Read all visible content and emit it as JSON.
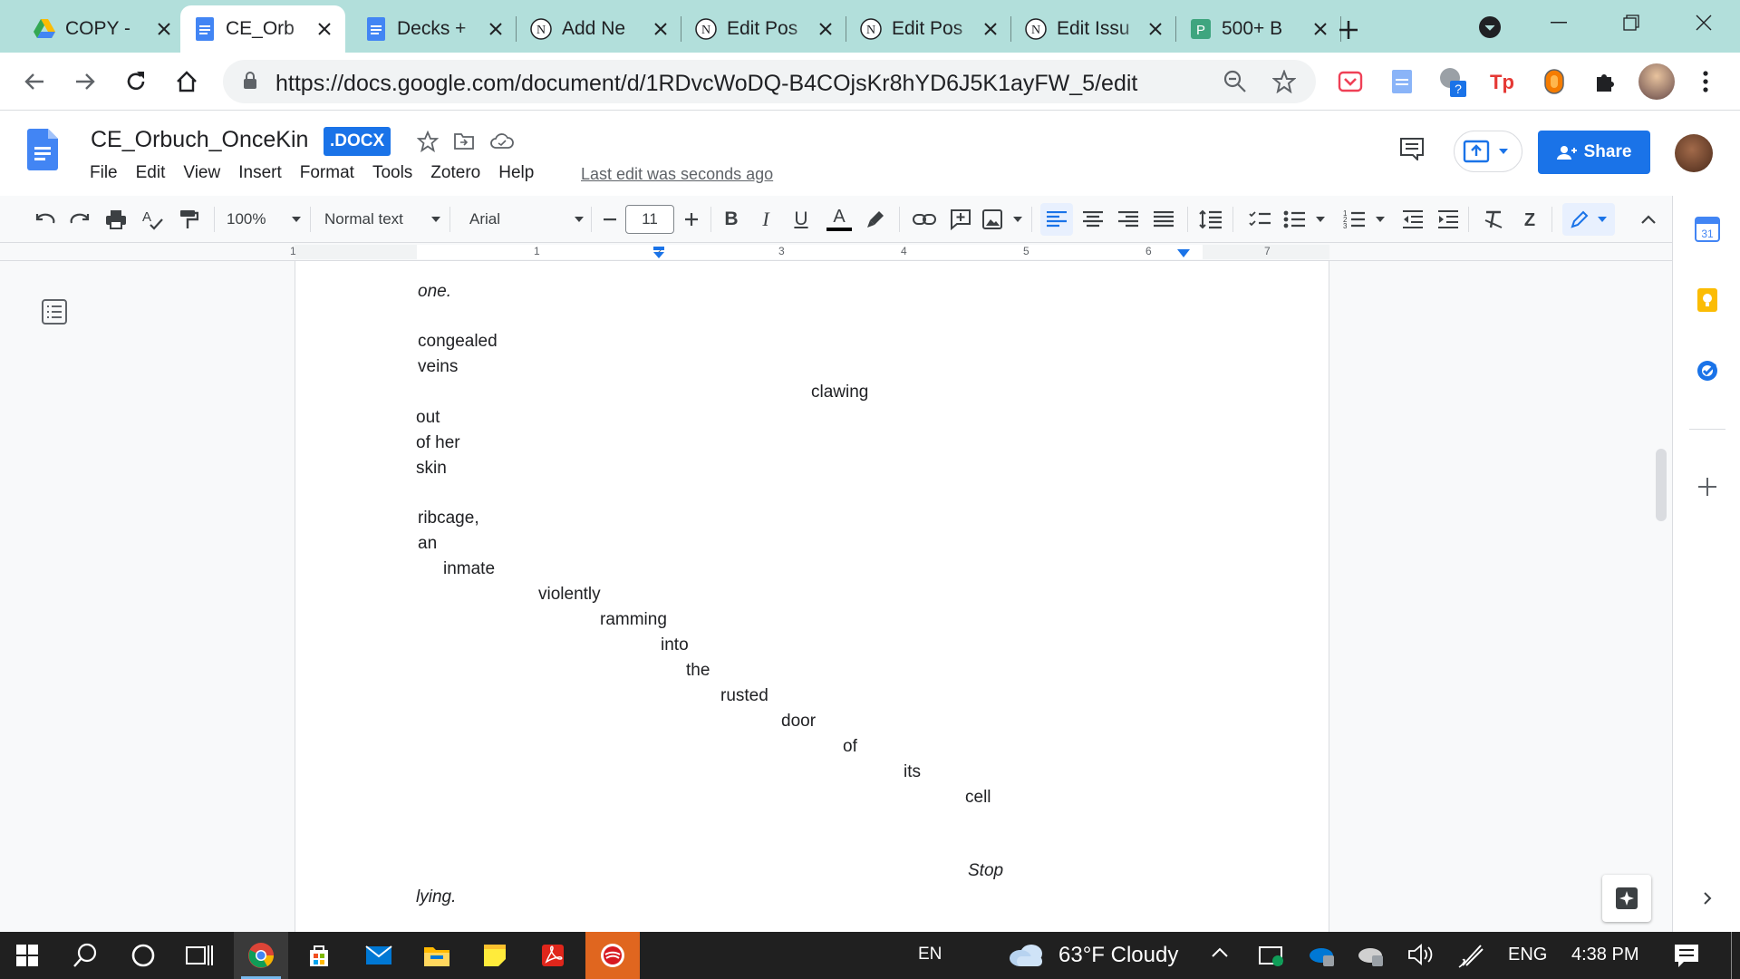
{
  "browser": {
    "tabs": [
      {
        "title": "COPY -",
        "icon": "google-drive-icon"
      },
      {
        "title": "CE_Orb",
        "icon": "google-docs-icon",
        "active": true
      },
      {
        "title": "Decks +",
        "icon": "google-docs-icon"
      },
      {
        "title": "Add Ne",
        "icon": "wordpress-icon"
      },
      {
        "title": "Edit Pos",
        "icon": "wordpress-icon"
      },
      {
        "title": "Edit Pos",
        "icon": "wordpress-icon"
      },
      {
        "title": "Edit Issu",
        "icon": "wordpress-icon"
      },
      {
        "title": "500+ B",
        "icon": "pressbooks-icon"
      }
    ],
    "url": "https://docs.google.com/document/d/1RDvcWoDQ-B4COjsKr8hYD6J5K1ayFW_5/edit"
  },
  "doc": {
    "title": "CE_Orbuch_OnceKin",
    "badge": ".DOCX",
    "menus": [
      "File",
      "Edit",
      "View",
      "Insert",
      "Format",
      "Tools",
      "Zotero",
      "Help"
    ],
    "last_edit": "Last edit was seconds ago",
    "share_label": "Share"
  },
  "toolbar": {
    "zoom": "100%",
    "style": "Normal text",
    "font": "Arial",
    "font_size": "11"
  },
  "ruler": {
    "numbers": [
      "1",
      "1",
      "2",
      "3",
      "4",
      "5",
      "6",
      "7"
    ]
  },
  "content": {
    "lines": [
      {
        "text": "one.",
        "italic": true
      },
      {
        "text": "congealed"
      },
      {
        "text": "veins"
      },
      {
        "text": "clawing"
      },
      {
        "text": "out"
      },
      {
        "text": "of her"
      },
      {
        "text": "skin"
      },
      {
        "text": "ribcage,"
      },
      {
        "text": "an"
      },
      {
        "text": "inmate"
      },
      {
        "text": "violently"
      },
      {
        "text": "ramming"
      },
      {
        "text": "into"
      },
      {
        "text": "the"
      },
      {
        "text": "rusted"
      },
      {
        "text": "door"
      },
      {
        "text": "of"
      },
      {
        "text": "its"
      },
      {
        "text": "cell"
      },
      {
        "text": "Stop",
        "italic": true
      },
      {
        "text": "lying.",
        "italic": true
      }
    ]
  },
  "taskbar": {
    "input": "EN",
    "weather": "63°F  Cloudy",
    "lang": "ENG",
    "time": "4:38 PM"
  },
  "colors": {
    "tab_bar": "#b2dfdb",
    "accent": "#1a73e8",
    "taskbar": "#202020"
  }
}
